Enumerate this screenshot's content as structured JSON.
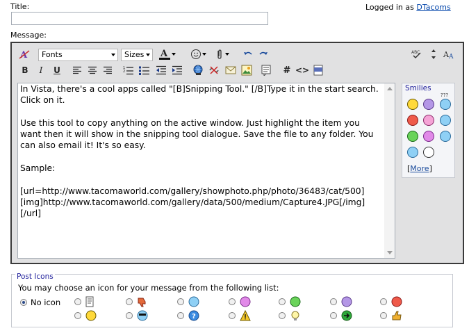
{
  "form": {
    "title_label": "Title:",
    "title_value": "",
    "message_label": "Message:"
  },
  "header": {
    "logged_prefix": "Logged in as",
    "username": "DTacoms"
  },
  "toolbar": {
    "font_select": "Fonts",
    "size_select": "Sizes",
    "bold": "B",
    "italic": "I",
    "underline": "U",
    "code_hash": "#",
    "code_angle": "<>",
    "php": "php"
  },
  "editor": {
    "text": "In Vista, there's a cool apps called \"[B]Snipping Tool.\" [/B]Type it in the start search. Click on it.\n\nUse this tool to copy anything on the active window. Just highlight the item you want then it will show in the snipping tool dialogue. Save the file to any folder. You can also email it! It's so easy.\n\nSample:\n\n[url=http://www.tacomaworld.com/gallery/showphoto.php/photo/36483/cat/500][img]http://www.tacomaworld.com/gallery/data/500/medium/Capture4.JPG[/img][/url]"
  },
  "smilies": {
    "heading": "Smilies",
    "question_marks": "???",
    "more_open": "[",
    "more_label": "More",
    "more_close": "]",
    "items": [
      "smile-icon",
      "frown-icon",
      "confused-icon",
      "mad-icon",
      "embarrassed-icon",
      "cool-icon",
      "grin-icon",
      "biggrin-icon",
      "wink-icon",
      "sunglasses-icon",
      "eek-icon"
    ]
  },
  "post_icons": {
    "legend": "Post Icons",
    "description": "You may choose an icon for your message from the following list:",
    "no_icon": "No icon",
    "selected": "no-icon"
  },
  "colors": {
    "editor_bg": "#e1e1e2",
    "link": "#0044aa",
    "legend": "#22229c"
  }
}
